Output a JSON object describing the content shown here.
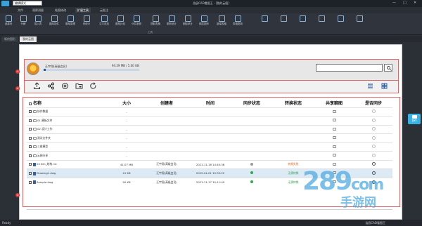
{
  "app": {
    "title": "浩辰CAD看图王 - [我的云图]",
    "mode": "编辑模式",
    "window_controls": [
      "—",
      "□",
      "✕"
    ]
  },
  "menu": [
    {
      "label": "文件",
      "active": false
    },
    {
      "label": "观察测量",
      "active": false
    },
    {
      "label": "绘图修改",
      "active": false
    },
    {
      "label": "扩展工具",
      "active": true
    },
    {
      "label": "云批注",
      "active": false
    }
  ],
  "ribbon": {
    "buttons": [
      "创建块",
      "分解",
      "插入表",
      "图库插件",
      "图库整理",
      "块统计",
      "文字查找",
      "图档比较",
      "分层参照",
      "提取表格",
      "图形统计",
      "删除统计",
      "图层图形",
      "新建表格",
      "表格更新",
      "",
      "",
      "",
      "",
      "",
      ""
    ],
    "group_label": "工具"
  },
  "doc_tabs": [
    {
      "label": "新的图形",
      "active": false
    },
    {
      "label": "我的云图",
      "active": true
    }
  ],
  "user": {
    "name": "汪宇翔(高级会员)",
    "quota": "94.29 MB / 5.00 GB",
    "quota_fraction": 0.02
  },
  "search": {
    "placeholder": "",
    "value": ""
  },
  "markers": [
    "①",
    "②",
    "③"
  ],
  "toolbar": {
    "actions": [
      "upload",
      "share",
      "delete",
      "new-folder",
      "refresh"
    ],
    "views": [
      "list-view",
      "grid-view"
    ]
  },
  "table": {
    "headers": [
      "名称",
      "大小",
      "创建者",
      "时间",
      "同步状态",
      "转换状态",
      "共享聊图",
      "是否同步"
    ],
    "rows": [
      {
        "name": "协作数据",
        "type": "folder",
        "size": "-",
        "creator": "",
        "time": "",
        "sync": "",
        "convert": "",
        "selected": false
      },
      {
        "name": "01-模板文件",
        "type": "folder",
        "size": "-",
        "creator": "",
        "time": "",
        "sync": "",
        "convert": "",
        "selected": false
      },
      {
        "name": "02-设计工作",
        "type": "folder",
        "size": "-",
        "creator": "",
        "time": "",
        "sync": "",
        "convert": "",
        "selected": false
      },
      {
        "name": "测试文件夹",
        "type": "folder",
        "size": "-",
        "creator": "",
        "time": "",
        "sync": "",
        "convert": "",
        "selected": false
      },
      {
        "name": "三维模型",
        "type": "folder",
        "size": "-",
        "creator": "",
        "time": "",
        "sync": "",
        "convert": "",
        "selected": false
      },
      {
        "name": "云图分享",
        "type": "folder",
        "size": "-",
        "creator": "",
        "time": "",
        "sync": "",
        "convert": "",
        "selected": false
      },
      {
        "name": "03 IDC_结构.rvt",
        "type": "file",
        "size": "41.07 MB",
        "creator": "汪宇翔(高级会员)",
        "time": "2021-11-16 14:40:38",
        "sync": "grey",
        "convert": "转换失败",
        "convert_color": "#e06a1c",
        "selected": false
      },
      {
        "name": "Drawing1.dwg",
        "type": "file",
        "size": "41 KB",
        "creator": "汪宇翔(高级会员)",
        "time": "2022-04-01 10:35:22",
        "sync": "green",
        "convert": "无需转换",
        "convert_color": "#2aa84a",
        "selected": true
      },
      {
        "name": "Sample.dwg",
        "type": "file",
        "size": "90 KB",
        "creator": "汪宇翔(高级会员)",
        "time": "2021-11-17 10:11:49",
        "sync": "green",
        "convert": "无需转换",
        "convert_color": "#2aa84a",
        "selected": false
      }
    ]
  },
  "side_pin": {
    "label": "协作"
  },
  "status": {
    "left": "Ready",
    "right1": "浩辰CAD看图王",
    "right2": ""
  },
  "watermark": {
    "big": "289",
    "mid": "com",
    "sub": "手游网"
  }
}
